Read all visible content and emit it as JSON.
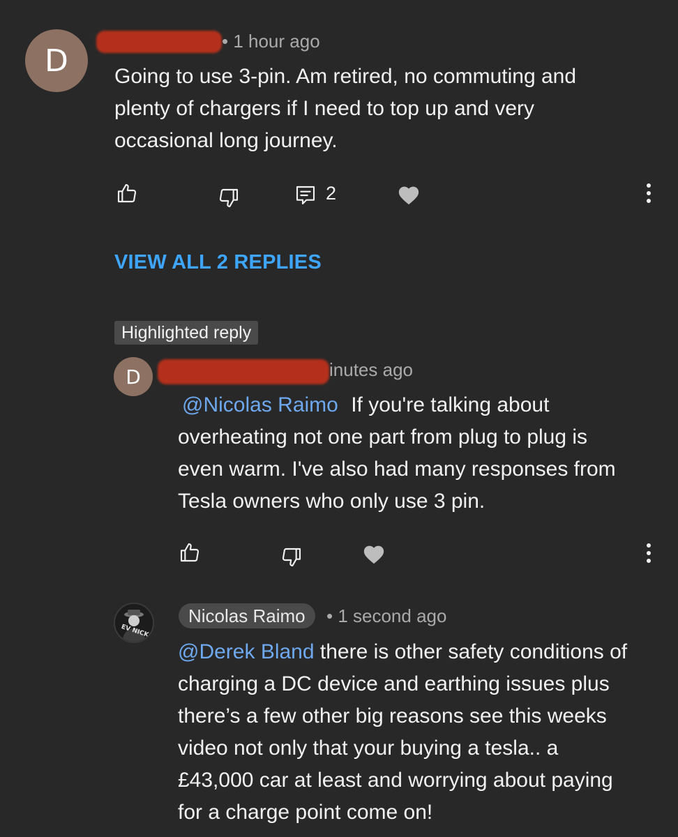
{
  "comment": {
    "avatar_letter": "D",
    "time": "• 1 hour ago",
    "text_lines": [
      "Going to use 3-pin. Am retired, no commuting and",
      "plenty of chargers if I need to top up and very",
      "occasional long journey."
    ],
    "reply_count": "2",
    "icons": {
      "like": "thumbs-up-icon",
      "dislike": "thumbs-down-icon",
      "reply": "comment-icon",
      "heart": "heart-icon",
      "menu": "more-vert-icon"
    }
  },
  "view_replies_label": "VIEW ALL 2 REPLIES",
  "highlighted_label": "Highlighted reply",
  "reply1": {
    "avatar_letter": "D",
    "time": "inutes ago",
    "mention": "@Nicolas Raimo",
    "text_first": "If you're talking about",
    "text_lines": [
      "overheating not one part from plug to plug is",
      "even warm. I've also had many responses from",
      "Tesla owners who only use 3 pin."
    ]
  },
  "reply2": {
    "author": "Nicolas Raimo",
    "avatar_text": "EV NICK",
    "time": "• 1 second ago",
    "mention": "@Derek Bland",
    "text_first": "there is other safety conditions of",
    "text_lines": [
      "charging a DC device and earthing issues plus",
      "there’s a few other big reasons see this weeks",
      "video not only that your buying a tesla.. a",
      "£43,000 car at least and worrying about paying",
      "for a charge point come on!"
    ]
  },
  "colors": {
    "background": "#282828",
    "accent_blue": "#3ea6ff",
    "mention_blue": "#6ea8ee",
    "redaction": "#b5301c",
    "avatar": "#8d7163"
  }
}
